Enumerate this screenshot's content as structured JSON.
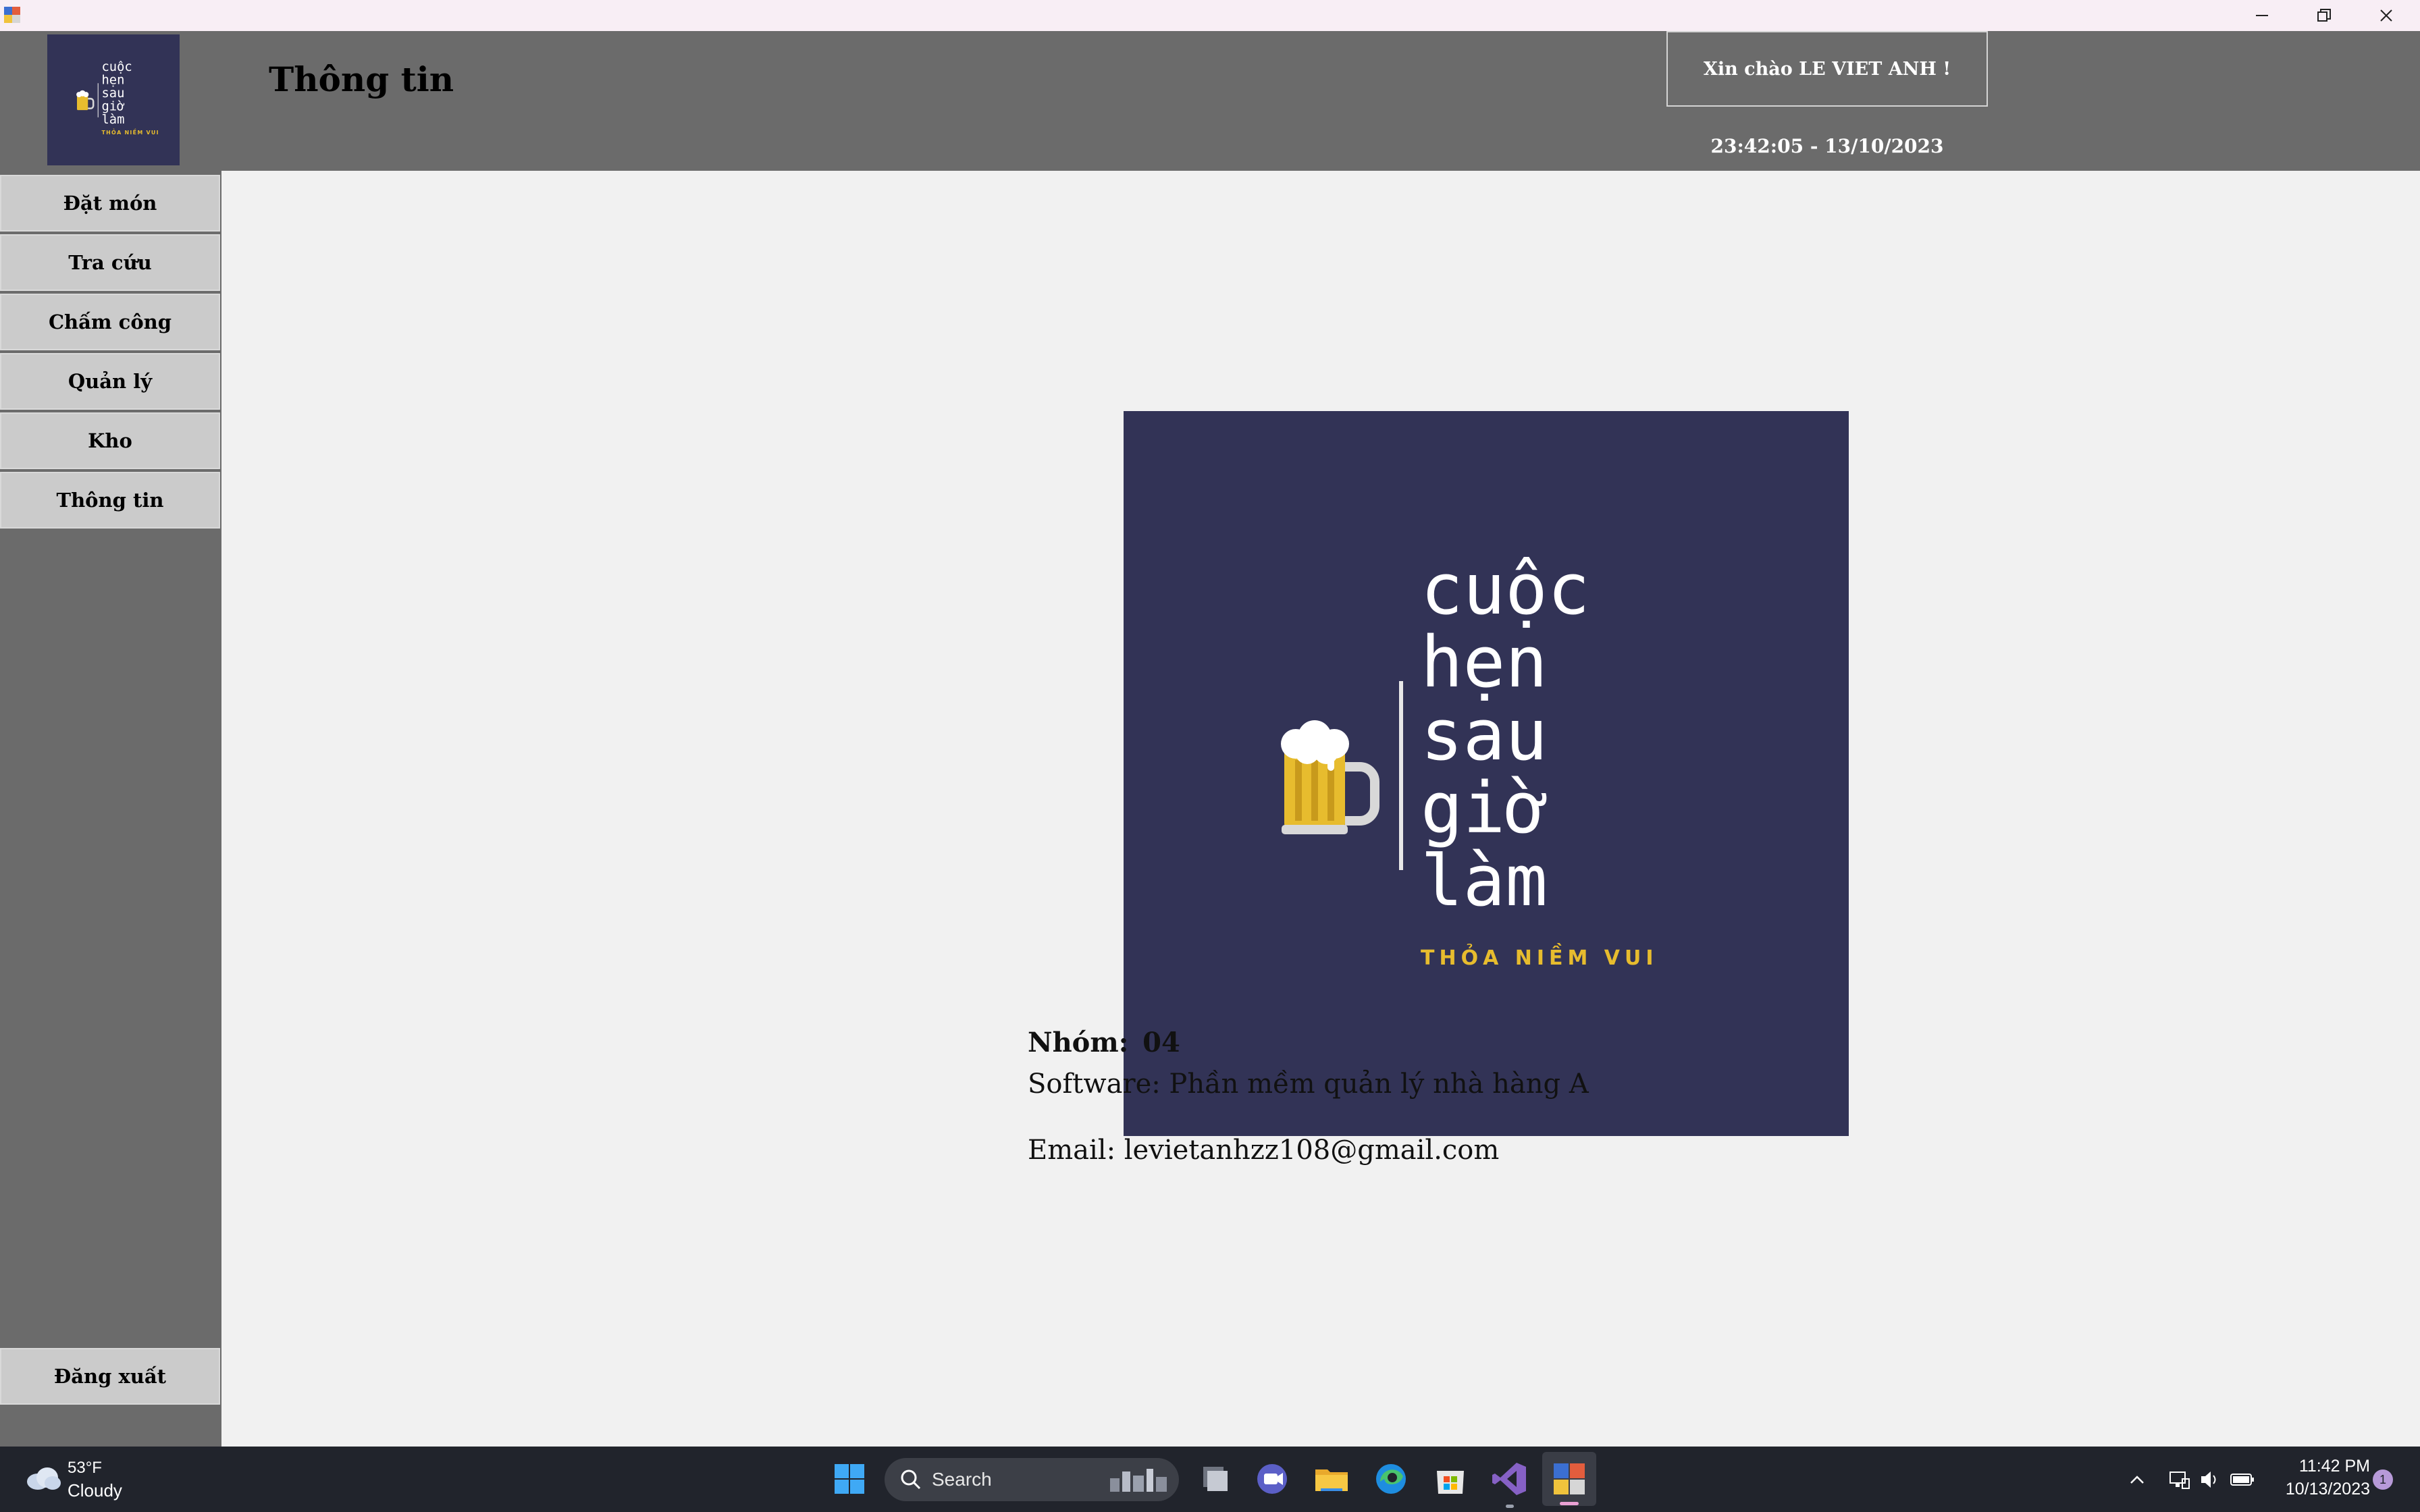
{
  "window": {
    "title": "",
    "controls": [
      "minimize",
      "restore",
      "close"
    ]
  },
  "header": {
    "page_title": "Thông tin",
    "greeting": "Xin chào LE VIET ANH !",
    "datetime": "23:42:05 - 13/10/2023"
  },
  "logo": {
    "lines": [
      "cuộc",
      "hẹn",
      "sau",
      "giờ",
      "làm"
    ],
    "tagline": "THỎA NIỀM VUI",
    "bg_color": "#323356",
    "tagline_color": "#e7bc2e"
  },
  "sidebar": {
    "items": [
      {
        "label": "Đặt món"
      },
      {
        "label": "Tra cứu"
      },
      {
        "label": "Chấm công"
      },
      {
        "label": "Quản lý"
      },
      {
        "label": "Kho"
      },
      {
        "label": "Thông tin"
      }
    ],
    "logout_label": "Đăng xuất"
  },
  "info": {
    "group_label": "Nhóm:",
    "group_value": "04",
    "software_line": "Software: Phần mềm quản lý nhà hàng A",
    "email_line": "Email: levietanhzz108@gmail.com"
  },
  "taskbar": {
    "weather_temp": "53°F",
    "weather_desc": "Cloudy",
    "search_placeholder": "Search",
    "time": "11:42 PM",
    "date": "10/13/2023",
    "notification_count": "1"
  },
  "colors": {
    "header_bg": "#6b6b6b",
    "nav_button_bg": "#cbcbcb",
    "main_bg": "#f1f1f1",
    "taskbar_bg": "#21242c"
  }
}
